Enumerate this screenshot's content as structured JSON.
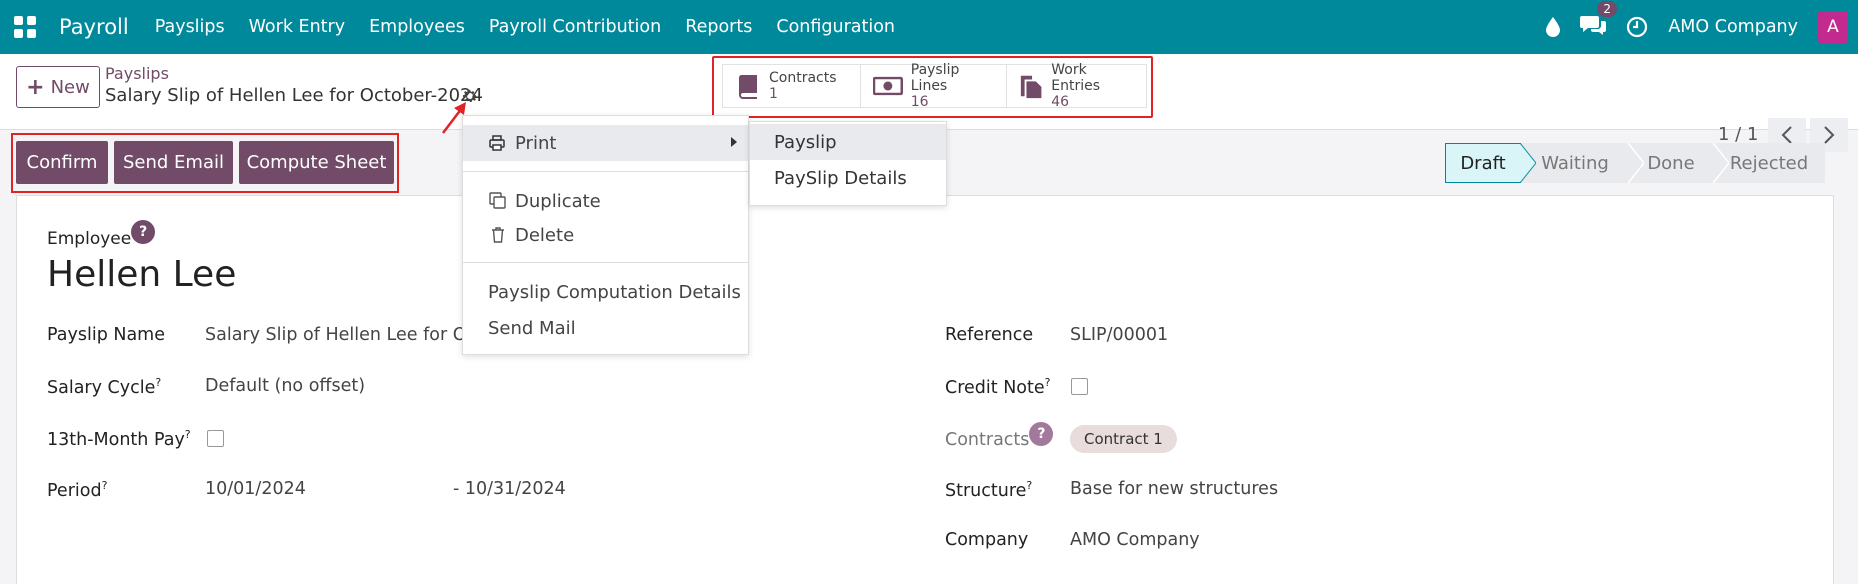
{
  "nav": {
    "brand": "Payroll",
    "items": [
      "Payslips",
      "Work Entry",
      "Employees",
      "Payroll Contribution",
      "Reports",
      "Configuration"
    ],
    "chat_count": "2",
    "company": "AMO Company",
    "avatar_letter": "A"
  },
  "control": {
    "new_label": "New",
    "breadcrumb": "Payslips",
    "record_title": "Salary Slip of Hellen Lee for October-2024",
    "pager": "1 / 1"
  },
  "smart_buttons": [
    {
      "label": "Contracts",
      "value": "1",
      "icon": "book-icon"
    },
    {
      "label": "Payslip Lines",
      "value": "16",
      "icon": "money-icon"
    },
    {
      "label": "Work Entries",
      "value": "46",
      "icon": "documents-icon"
    }
  ],
  "actions": {
    "confirm": "Confirm",
    "send_email": "Send Email",
    "compute_sheet": "Compute Sheet"
  },
  "statusbar": [
    "Draft",
    "Waiting",
    "Done",
    "Rejected"
  ],
  "statusbar_active": "Draft",
  "gear_menu": {
    "print": "Print",
    "duplicate": "Duplicate",
    "delete": "Delete",
    "computation_details": "Payslip Computation Details",
    "send_mail": "Send Mail"
  },
  "print_submenu": [
    "Payslip",
    "PaySlip Details"
  ],
  "form": {
    "employee_label": "Employee",
    "employee_name": "Hellen Lee",
    "payslip_name_label": "Payslip Name",
    "payslip_name_value": "Salary Slip of Hellen Lee for Oc",
    "salary_cycle_label": "Salary Cycle",
    "salary_cycle_value": "Default (no offset)",
    "thirteenth_label": "13th-Month Pay",
    "period_label": "Period",
    "period_from": "10/01/2024",
    "period_to": "- 10/31/2024",
    "reference_label": "Reference",
    "reference_value": "SLIP/00001",
    "credit_note_label": "Credit Note",
    "contracts_label": "Contracts",
    "contract_tag": "Contract 1",
    "structure_label": "Structure",
    "structure_value": "Base for new structures",
    "company_label": "Company",
    "company_value": "AMO Company"
  },
  "colors": {
    "nav": "#00899b",
    "primary": "#714b67",
    "highlight_box": "#e02424"
  }
}
